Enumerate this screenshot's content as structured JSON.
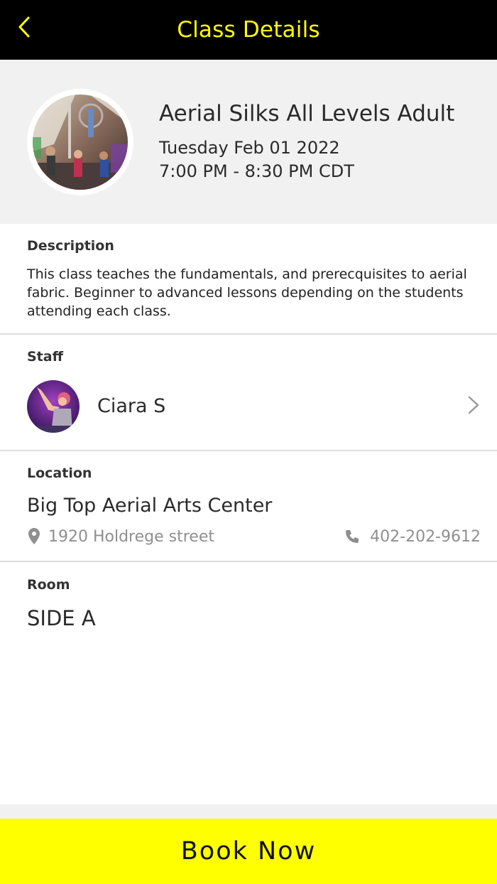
{
  "colors": {
    "accent": "#ffff00",
    "topbar_bg": "#000000",
    "header_bg": "#f1f1f1",
    "muted_text": "#8f8f8f"
  },
  "topbar": {
    "title": "Class Details",
    "back_icon": "chevron-left-icon"
  },
  "class": {
    "name": "Aerial Silks All Levels Adult",
    "date": "Tuesday Feb 01 2022",
    "time": "7:00 PM - 8:30 PM CDT"
  },
  "description": {
    "label": "Description",
    "text": "This class teaches the fundamentals, and prerecquisites to aerial fabric. Beginner to advanced lessons depending on the students attending each class."
  },
  "staff": {
    "label": "Staff",
    "name": "Ciara S",
    "chevron_icon": "chevron-right-icon"
  },
  "location": {
    "label": "Location",
    "name": "Big Top Aerial Arts Center",
    "address": "1920 Holdrege street",
    "address_icon": "map-pin-icon",
    "phone": "402-202-9612",
    "phone_icon": "phone-icon"
  },
  "room": {
    "label": "Room",
    "value": "SIDE A"
  },
  "book_button": {
    "label": "Book Now"
  }
}
